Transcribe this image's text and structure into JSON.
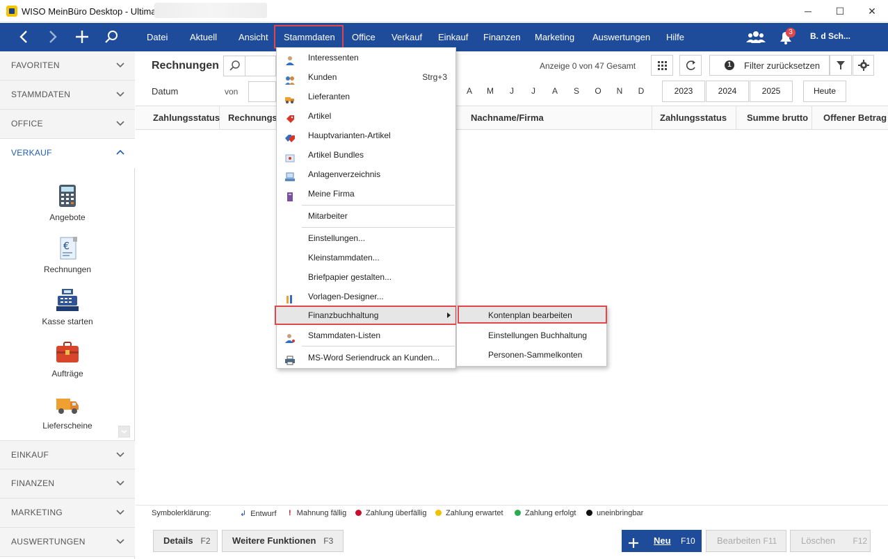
{
  "window": {
    "title": "WISO MeinBüro Desktop - Ultimate",
    "minimize": "─",
    "maximize": "☐",
    "close": "✕"
  },
  "toolbar": {
    "menu": [
      "Datei",
      "Aktuell",
      "Ansicht",
      "Stammdaten",
      "Office",
      "Verkauf",
      "Einkauf",
      "Finanzen",
      "Marketing",
      "Auswertungen",
      "Hilfe"
    ],
    "notification_count": "3",
    "user": "B. d Sch..."
  },
  "sidebar": {
    "sections": [
      "FAVORITEN",
      "STAMMDATEN",
      "OFFICE",
      "VERKAUF",
      "EINKAUF",
      "FINANZEN",
      "MARKETING",
      "AUSWERTUNGEN"
    ],
    "verkauf_items": [
      "Angebote",
      "Rechnungen",
      "Kasse starten",
      "Aufträge",
      "Lieferscheine"
    ]
  },
  "content": {
    "title": "Rechnungen",
    "datum_label": "Datum",
    "von_label": "von",
    "count_text": "Anzeige 0 von 47 Gesamt",
    "filter_count": "1",
    "filter_reset": "Filter zurücksetzen",
    "months": [
      "A",
      "M",
      "J",
      "J",
      "A",
      "S",
      "O",
      "N",
      "D"
    ],
    "years": [
      "2023",
      "2024",
      "2025"
    ],
    "heute": "Heute",
    "columns": [
      "Zahlungsstatus",
      "Rechnungs",
      "Nachname/Firma",
      "Zahlungsstatus",
      "Summe brutto",
      "Offener Betrag"
    ]
  },
  "legend": {
    "label": "Symbolerklärung:",
    "items": [
      {
        "text": "Entwurf",
        "symbol": "↲",
        "color": "#1e4c9a"
      },
      {
        "text": "Mahnung fällig",
        "symbol": "!",
        "color": "#c8102e"
      },
      {
        "text": "Zahlung überfällig",
        "symbol": "●",
        "color": "#c8102e"
      },
      {
        "text": "Zahlung erwartet",
        "symbol": "●",
        "color": "#f2c200"
      },
      {
        "text": "Zahlung erfolgt",
        "symbol": "●",
        "color": "#2daa4f"
      },
      {
        "text": "uneinbringbar",
        "symbol": "●",
        "color": "#111111"
      }
    ]
  },
  "bottom": {
    "details": "Details",
    "details_key": "F2",
    "weitere": "Weitere Funktionen",
    "weitere_key": "F3",
    "neu": "Neu",
    "neu_key": "F10",
    "bearbeiten": "Bearbeiten",
    "bearbeiten_key": "F11",
    "loeschen": "Löschen",
    "loeschen_key": "F12"
  },
  "dropdown": {
    "items": [
      {
        "label": "Interessenten",
        "shortcut": ""
      },
      {
        "label": "Kunden",
        "shortcut": "Strg+3"
      },
      {
        "label": "Lieferanten",
        "shortcut": ""
      },
      {
        "label": "Artikel",
        "shortcut": ""
      },
      {
        "label": "Hauptvarianten-Artikel",
        "shortcut": ""
      },
      {
        "label": "Artikel Bundles",
        "shortcut": ""
      },
      {
        "label": "Anlagenverzeichnis",
        "shortcut": ""
      },
      {
        "label": "Meine Firma",
        "shortcut": ""
      },
      {
        "label": "Mitarbeiter",
        "shortcut": ""
      },
      {
        "label": "Einstellungen...",
        "shortcut": ""
      },
      {
        "label": "Kleinstammdaten...",
        "shortcut": ""
      },
      {
        "label": "Briefpapier gestalten...",
        "shortcut": ""
      },
      {
        "label": "Vorlagen-Designer...",
        "shortcut": ""
      },
      {
        "label": "Finanzbuchhaltung",
        "shortcut": ""
      },
      {
        "label": "Stammdaten-Listen",
        "shortcut": ""
      },
      {
        "label": "MS-Word Seriendruck an Kunden...",
        "shortcut": ""
      }
    ]
  },
  "submenu": {
    "items": [
      "Kontenplan bearbeiten",
      "Einstellungen Buchhaltung",
      "Personen-Sammelkonten"
    ]
  },
  "colors": {
    "accent": "#1e4c9a",
    "highlight": "#e0464a",
    "verkauf": "#1e5cb3"
  }
}
